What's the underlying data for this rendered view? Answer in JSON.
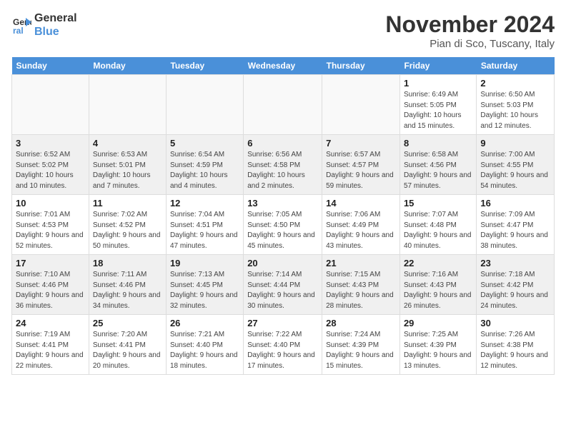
{
  "logo": {
    "line1": "General",
    "line2": "Blue"
  },
  "title": "November 2024",
  "subtitle": "Pian di Sco, Tuscany, Italy",
  "days_of_week": [
    "Sunday",
    "Monday",
    "Tuesday",
    "Wednesday",
    "Thursday",
    "Friday",
    "Saturday"
  ],
  "weeks": [
    [
      {
        "num": "",
        "info": ""
      },
      {
        "num": "",
        "info": ""
      },
      {
        "num": "",
        "info": ""
      },
      {
        "num": "",
        "info": ""
      },
      {
        "num": "",
        "info": ""
      },
      {
        "num": "1",
        "info": "Sunrise: 6:49 AM\nSunset: 5:05 PM\nDaylight: 10 hours and 15 minutes."
      },
      {
        "num": "2",
        "info": "Sunrise: 6:50 AM\nSunset: 5:03 PM\nDaylight: 10 hours and 12 minutes."
      }
    ],
    [
      {
        "num": "3",
        "info": "Sunrise: 6:52 AM\nSunset: 5:02 PM\nDaylight: 10 hours and 10 minutes."
      },
      {
        "num": "4",
        "info": "Sunrise: 6:53 AM\nSunset: 5:01 PM\nDaylight: 10 hours and 7 minutes."
      },
      {
        "num": "5",
        "info": "Sunrise: 6:54 AM\nSunset: 4:59 PM\nDaylight: 10 hours and 4 minutes."
      },
      {
        "num": "6",
        "info": "Sunrise: 6:56 AM\nSunset: 4:58 PM\nDaylight: 10 hours and 2 minutes."
      },
      {
        "num": "7",
        "info": "Sunrise: 6:57 AM\nSunset: 4:57 PM\nDaylight: 9 hours and 59 minutes."
      },
      {
        "num": "8",
        "info": "Sunrise: 6:58 AM\nSunset: 4:56 PM\nDaylight: 9 hours and 57 minutes."
      },
      {
        "num": "9",
        "info": "Sunrise: 7:00 AM\nSunset: 4:55 PM\nDaylight: 9 hours and 54 minutes."
      }
    ],
    [
      {
        "num": "10",
        "info": "Sunrise: 7:01 AM\nSunset: 4:53 PM\nDaylight: 9 hours and 52 minutes."
      },
      {
        "num": "11",
        "info": "Sunrise: 7:02 AM\nSunset: 4:52 PM\nDaylight: 9 hours and 50 minutes."
      },
      {
        "num": "12",
        "info": "Sunrise: 7:04 AM\nSunset: 4:51 PM\nDaylight: 9 hours and 47 minutes."
      },
      {
        "num": "13",
        "info": "Sunrise: 7:05 AM\nSunset: 4:50 PM\nDaylight: 9 hours and 45 minutes."
      },
      {
        "num": "14",
        "info": "Sunrise: 7:06 AM\nSunset: 4:49 PM\nDaylight: 9 hours and 43 minutes."
      },
      {
        "num": "15",
        "info": "Sunrise: 7:07 AM\nSunset: 4:48 PM\nDaylight: 9 hours and 40 minutes."
      },
      {
        "num": "16",
        "info": "Sunrise: 7:09 AM\nSunset: 4:47 PM\nDaylight: 9 hours and 38 minutes."
      }
    ],
    [
      {
        "num": "17",
        "info": "Sunrise: 7:10 AM\nSunset: 4:46 PM\nDaylight: 9 hours and 36 minutes."
      },
      {
        "num": "18",
        "info": "Sunrise: 7:11 AM\nSunset: 4:46 PM\nDaylight: 9 hours and 34 minutes."
      },
      {
        "num": "19",
        "info": "Sunrise: 7:13 AM\nSunset: 4:45 PM\nDaylight: 9 hours and 32 minutes."
      },
      {
        "num": "20",
        "info": "Sunrise: 7:14 AM\nSunset: 4:44 PM\nDaylight: 9 hours and 30 minutes."
      },
      {
        "num": "21",
        "info": "Sunrise: 7:15 AM\nSunset: 4:43 PM\nDaylight: 9 hours and 28 minutes."
      },
      {
        "num": "22",
        "info": "Sunrise: 7:16 AM\nSunset: 4:43 PM\nDaylight: 9 hours and 26 minutes."
      },
      {
        "num": "23",
        "info": "Sunrise: 7:18 AM\nSunset: 4:42 PM\nDaylight: 9 hours and 24 minutes."
      }
    ],
    [
      {
        "num": "24",
        "info": "Sunrise: 7:19 AM\nSunset: 4:41 PM\nDaylight: 9 hours and 22 minutes."
      },
      {
        "num": "25",
        "info": "Sunrise: 7:20 AM\nSunset: 4:41 PM\nDaylight: 9 hours and 20 minutes."
      },
      {
        "num": "26",
        "info": "Sunrise: 7:21 AM\nSunset: 4:40 PM\nDaylight: 9 hours and 18 minutes."
      },
      {
        "num": "27",
        "info": "Sunrise: 7:22 AM\nSunset: 4:40 PM\nDaylight: 9 hours and 17 minutes."
      },
      {
        "num": "28",
        "info": "Sunrise: 7:24 AM\nSunset: 4:39 PM\nDaylight: 9 hours and 15 minutes."
      },
      {
        "num": "29",
        "info": "Sunrise: 7:25 AM\nSunset: 4:39 PM\nDaylight: 9 hours and 13 minutes."
      },
      {
        "num": "30",
        "info": "Sunrise: 7:26 AM\nSunset: 4:38 PM\nDaylight: 9 hours and 12 minutes."
      }
    ]
  ]
}
